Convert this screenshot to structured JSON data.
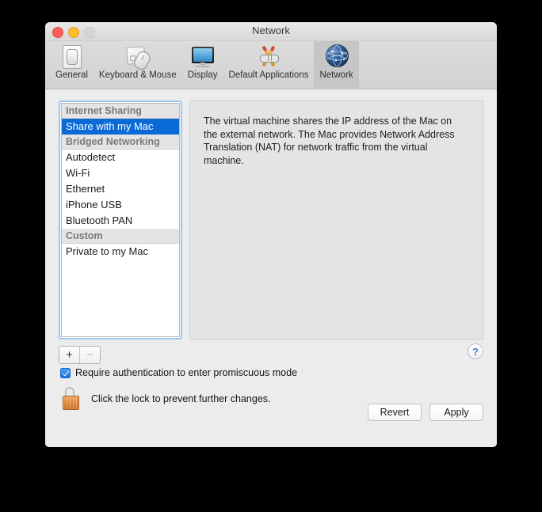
{
  "window": {
    "title": "Network",
    "controls": {
      "close": "close-button",
      "minimize": "minimize-button",
      "zoom": "zoom-button"
    }
  },
  "toolbar": {
    "items": [
      {
        "label": "General",
        "icon": "general-switch-icon",
        "selected": false
      },
      {
        "label": "Keyboard & Mouse",
        "icon": "keyboard-mouse-icon",
        "selected": false
      },
      {
        "label": "Display",
        "icon": "display-monitor-icon",
        "selected": false
      },
      {
        "label": "Default Applications",
        "icon": "default-applications-tools-icon",
        "selected": false
      },
      {
        "label": "Network",
        "icon": "network-globe-icon",
        "selected": true
      }
    ]
  },
  "sidebar": {
    "groups": [
      {
        "header": "Internet Sharing",
        "items": [
          {
            "label": "Share with my Mac",
            "selected": true
          }
        ]
      },
      {
        "header": "Bridged Networking",
        "items": [
          {
            "label": "Autodetect",
            "selected": false
          },
          {
            "label": "Wi-Fi",
            "selected": false
          },
          {
            "label": "Ethernet",
            "selected": false
          },
          {
            "label": "iPhone USB",
            "selected": false
          },
          {
            "label": "Bluetooth PAN",
            "selected": false
          }
        ]
      },
      {
        "header": "Custom",
        "items": [
          {
            "label": "Private to my Mac",
            "selected": false
          }
        ]
      }
    ],
    "add_label": "+",
    "remove_label": "−"
  },
  "detail": {
    "description": "The virtual machine shares the IP address of the Mac on the external network. The Mac provides Network Address Translation (NAT) for network traffic from the virtual machine."
  },
  "help": {
    "label": "?"
  },
  "options": {
    "promiscuous_label": "Require authentication to enter promiscuous mode",
    "promiscuous_checked": true
  },
  "lock": {
    "label": "Click the lock to prevent further changes.",
    "state": "unlocked"
  },
  "buttons": {
    "revert": "Revert",
    "apply": "Apply"
  },
  "colors": {
    "selection_blue": "#0a6bd6",
    "focus_ring": "#9cc6ef",
    "help_blue": "#2f7fe0",
    "lock_orange": "#e08a3c"
  }
}
